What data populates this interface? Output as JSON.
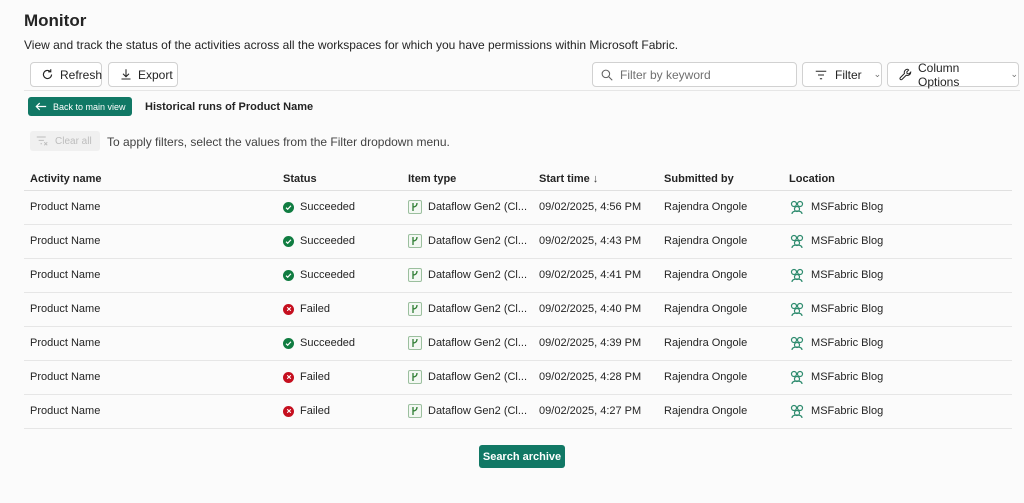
{
  "page": {
    "title": "Monitor",
    "subtitle": "View and track the status of the activities across all the workspaces for which you have permissions within Microsoft Fabric."
  },
  "toolbar": {
    "refresh_label": "Refresh",
    "export_label": "Export",
    "search_placeholder": "Filter by keyword",
    "filter_label": "Filter",
    "column_options_label": "Column Options"
  },
  "subheader": {
    "back_label": "Back to main view",
    "historical_label": "Historical runs of Product Name"
  },
  "filters": {
    "clear_all_label": "Clear all",
    "hint": "To apply filters, select the values from the Filter dropdown menu."
  },
  "table": {
    "columns": [
      "Activity name",
      "Status",
      "Item type",
      "Start time",
      "Submitted by",
      "Location"
    ],
    "rows": [
      {
        "activity": "Product Name",
        "status": "Succeeded",
        "item_type": "Dataflow Gen2 (Cl...",
        "start": "09/02/2025, 4:56 PM",
        "submitted": "Rajendra Ongole",
        "location": "MSFabric Blog"
      },
      {
        "activity": "Product Name",
        "status": "Succeeded",
        "item_type": "Dataflow Gen2 (Cl...",
        "start": "09/02/2025, 4:43 PM",
        "submitted": "Rajendra Ongole",
        "location": "MSFabric Blog"
      },
      {
        "activity": "Product Name",
        "status": "Succeeded",
        "item_type": "Dataflow Gen2 (Cl...",
        "start": "09/02/2025, 4:41 PM",
        "submitted": "Rajendra Ongole",
        "location": "MSFabric Blog"
      },
      {
        "activity": "Product Name",
        "status": "Failed",
        "item_type": "Dataflow Gen2 (Cl...",
        "start": "09/02/2025, 4:40 PM",
        "submitted": "Rajendra Ongole",
        "location": "MSFabric Blog"
      },
      {
        "activity": "Product Name",
        "status": "Succeeded",
        "item_type": "Dataflow Gen2 (Cl...",
        "start": "09/02/2025, 4:39 PM",
        "submitted": "Rajendra Ongole",
        "location": "MSFabric Blog"
      },
      {
        "activity": "Product Name",
        "status": "Failed",
        "item_type": "Dataflow Gen2 (Cl...",
        "start": "09/02/2025, 4:28 PM",
        "submitted": "Rajendra Ongole",
        "location": "MSFabric Blog"
      },
      {
        "activity": "Product Name",
        "status": "Failed",
        "item_type": "Dataflow Gen2 (Cl...",
        "start": "09/02/2025, 4:27 PM",
        "submitted": "Rajendra Ongole",
        "location": "MSFabric Blog"
      }
    ]
  },
  "footer": {
    "search_archive_label": "Search archive"
  },
  "colors": {
    "accent": "#117865",
    "success": "#107c41",
    "failure": "#c50f1f"
  },
  "icons": {
    "refresh": "refresh-icon",
    "export": "download-icon",
    "search": "search-icon",
    "filter": "filter-icon",
    "column_options": "wrench-icon",
    "back": "arrow-left-icon",
    "clear": "clear-filter-icon",
    "sort": "arrow-down-icon",
    "succeeded": "check-circle-icon",
    "failed": "x-circle-icon",
    "dataflow": "dataflow-icon",
    "workspace": "workspace-icon"
  }
}
